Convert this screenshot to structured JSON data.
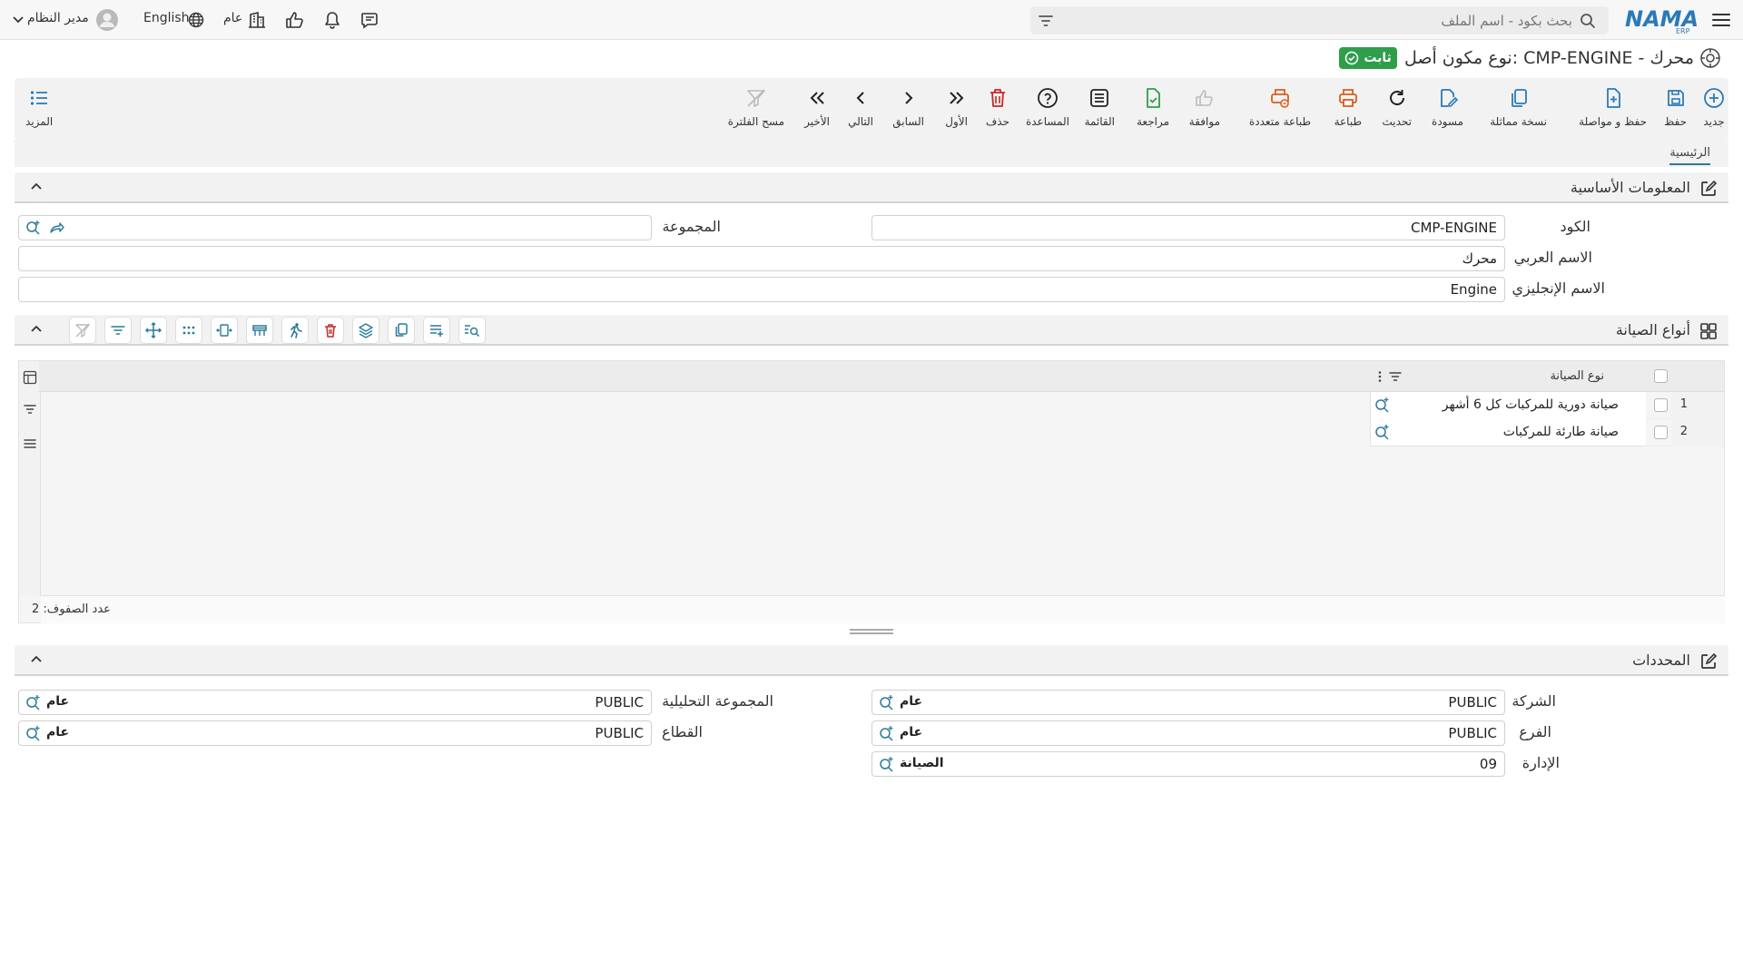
{
  "header": {
    "search_placeholder": "بحث بكود - اسم الملف",
    "user_name": "مدير النظام",
    "language": "English",
    "scope": "عام"
  },
  "title": {
    "text": "نوع مكون أصل: CMP-ENGINE - محرك",
    "status": "ثابت"
  },
  "toolbar": {
    "new": "جديد",
    "save": "حفظ",
    "save_continue": "حفظ و مواصلة",
    "duplicate": "نسخة مماثلة",
    "draft": "مسودة",
    "refresh": "تحديث",
    "print": "طباعة",
    "multi_print": "طباعة متعددة",
    "approve": "موافقة",
    "review": "مراجعة",
    "list": "القائمة",
    "help": "المساعدة",
    "delete": "حذف",
    "first": "الأول",
    "previous": "السابق",
    "next": "التالي",
    "last": "الأخير",
    "clear_filter": "مسح الفلترة",
    "more": "المزيد"
  },
  "tabs": {
    "main": "الرئيسية"
  },
  "basic_info": {
    "title": "المعلومات الأساسية",
    "code_label": "الكود",
    "code_value": "CMP-ENGINE",
    "group_label": "المجموعة",
    "group_value": "",
    "arabic_name_label": "الاسم العربي",
    "arabic_name_value": "محرك",
    "english_name_label": "الاسم الإنجليزي",
    "english_name_value": "Engine"
  },
  "maintenance_types": {
    "title": "أنواع الصيانة",
    "column_header": "نوع الصيانة",
    "rows": [
      {
        "num": "1",
        "name": "صيانة دورية للمركبات كل 6 أشهر"
      },
      {
        "num": "2",
        "name": "صيانة طارئة للمركبات"
      }
    ],
    "row_count_text": "عدد الصفوف: 2"
  },
  "dimensions": {
    "title": "المحددات",
    "company_label": "الشركة",
    "company_code": "PUBLIC",
    "company_name": "عام",
    "analytic_group_label": "المجموعة التحليلية",
    "analytic_group_code": "PUBLIC",
    "analytic_group_name": "عام",
    "branch_label": "الفرع",
    "branch_code": "PUBLIC",
    "branch_name": "عام",
    "sector_label": "القطاع",
    "sector_code": "PUBLIC",
    "sector_name": "عام",
    "department_label": "الإدارة",
    "department_code": "09",
    "department_name": "الصيانة"
  },
  "colors": {
    "brand_blue": "#2b7ab8",
    "status_green": "#2e9e4a",
    "delete_red": "#c62828",
    "print_orange": "#e05a1b",
    "teal_icon": "#2b7a99"
  }
}
